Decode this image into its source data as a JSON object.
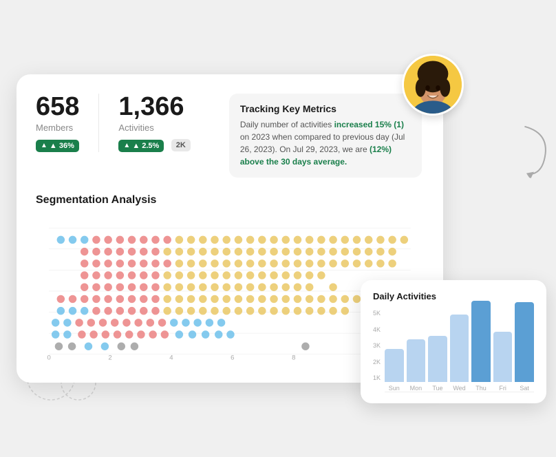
{
  "metrics": {
    "members": {
      "value": "658",
      "label": "Members",
      "badge": "▲ 36%"
    },
    "activities": {
      "value": "1,366",
      "label": "Activities",
      "badge": "▲ 2.5%",
      "extra": "2K"
    }
  },
  "tracking": {
    "title": "Tracking Key Metrics",
    "text_before_1": "Daily number of activities ",
    "highlight_1": "increased 15% (1)",
    "text_mid_1": " on 2023 when compared to previous day (Jul 26, 2023). On Jul 29, 2023, we are ",
    "highlight_2": "(12%) above the 30 days average.",
    "text_after_2": ""
  },
  "segmentation": {
    "title": "Segmentation Analysis"
  },
  "daily": {
    "title": "Daily Activities",
    "y_labels": [
      "5K",
      "4K",
      "3K",
      "2K",
      "1K"
    ],
    "bars": [
      {
        "day": "Sun",
        "value": 2000,
        "max": 5000,
        "highlight": false
      },
      {
        "day": "Mon",
        "value": 2600,
        "max": 5000,
        "highlight": false
      },
      {
        "day": "Tue",
        "value": 2800,
        "max": 5000,
        "highlight": false
      },
      {
        "day": "Wed",
        "value": 4100,
        "max": 5000,
        "highlight": false
      },
      {
        "day": "Thu",
        "value": 4900,
        "max": 5000,
        "highlight": true
      },
      {
        "day": "Fri",
        "value": 3050,
        "max": 5000,
        "highlight": false
      },
      {
        "day": "Sat",
        "value": 4850,
        "max": 5000,
        "highlight": true
      }
    ]
  },
  "scatter_dots": {
    "rows": [
      {
        "y": 190,
        "dots": [
          {
            "x": 10,
            "c": "#888"
          },
          {
            "x": 30,
            "c": "#888"
          },
          {
            "x": 50,
            "c": "#5bb8e8"
          },
          {
            "x": 75,
            "c": "#5bb8e8"
          },
          {
            "x": 95,
            "c": "#888"
          },
          {
            "x": 115,
            "c": "#888"
          }
        ]
      },
      {
        "y": 175,
        "dots": [
          {
            "x": 10,
            "c": "#5bb8e8"
          },
          {
            "x": 25,
            "c": "#5bb8e8"
          },
          {
            "x": 45,
            "c": "#e87070"
          },
          {
            "x": 60,
            "c": "#e87070"
          },
          {
            "x": 80,
            "c": "#e87070"
          },
          {
            "x": 95,
            "c": "#e87070"
          },
          {
            "x": 115,
            "c": "#e87070"
          },
          {
            "x": 135,
            "c": "#e87070"
          },
          {
            "x": 155,
            "c": "#e87070"
          },
          {
            "x": 175,
            "c": "#e87070"
          },
          {
            "x": 195,
            "c": "#5bb8e8"
          },
          {
            "x": 215,
            "c": "#5bb8e8"
          },
          {
            "x": 235,
            "c": "#5bb8e8"
          },
          {
            "x": 255,
            "c": "#5bb8e8"
          },
          {
            "x": 270,
            "c": "#5bb8e8"
          },
          {
            "x": 285,
            "c": "#888"
          },
          {
            "x": 380,
            "c": "#888"
          }
        ]
      },
      {
        "y": 158,
        "dots": [
          {
            "x": 10,
            "c": "#5bb8e8"
          },
          {
            "x": 25,
            "c": "#5bb8e8"
          },
          {
            "x": 42,
            "c": "#e87070"
          },
          {
            "x": 58,
            "c": "#e87070"
          },
          {
            "x": 75,
            "c": "#e87070"
          },
          {
            "x": 92,
            "c": "#e87070"
          },
          {
            "x": 108,
            "c": "#e87070"
          },
          {
            "x": 125,
            "c": "#e87070"
          },
          {
            "x": 142,
            "c": "#e87070"
          },
          {
            "x": 158,
            "c": "#e87070"
          },
          {
            "x": 175,
            "c": "#e87070"
          },
          {
            "x": 192,
            "c": "#5bb8e8"
          },
          {
            "x": 210,
            "c": "#5bb8e8"
          },
          {
            "x": 228,
            "c": "#5bb8e8"
          },
          {
            "x": 245,
            "c": "#5bb8e8"
          }
        ]
      },
      {
        "y": 140,
        "dots": [
          {
            "x": 18,
            "c": "#5bb8e8"
          },
          {
            "x": 35,
            "c": "#5bb8e8"
          },
          {
            "x": 52,
            "c": "#5bb8e8"
          },
          {
            "x": 70,
            "c": "#e87070"
          },
          {
            "x": 88,
            "c": "#e87070"
          },
          {
            "x": 106,
            "c": "#e87070"
          },
          {
            "x": 123,
            "c": "#e87070"
          },
          {
            "x": 140,
            "c": "#e87070"
          },
          {
            "x": 158,
            "c": "#e87070"
          },
          {
            "x": 175,
            "c": "#e87070"
          },
          {
            "x": 193,
            "c": "#e8c45b"
          },
          {
            "x": 212,
            "c": "#e8c45b"
          },
          {
            "x": 232,
            "c": "#e8c45b"
          },
          {
            "x": 252,
            "c": "#e8c45b"
          },
          {
            "x": 270,
            "c": "#e8c45b"
          },
          {
            "x": 288,
            "c": "#e8c45b"
          },
          {
            "x": 306,
            "c": "#e8c45b"
          },
          {
            "x": 324,
            "c": "#e8c45b"
          },
          {
            "x": 342,
            "c": "#e8c45b"
          },
          {
            "x": 360,
            "c": "#e8c45b"
          },
          {
            "x": 378,
            "c": "#e8c45b"
          },
          {
            "x": 398,
            "c": "#e8c45b"
          },
          {
            "x": 416,
            "c": "#e8c45b"
          },
          {
            "x": 432,
            "c": "#e8c45b"
          },
          {
            "x": 448,
            "c": "#e8c45b"
          }
        ]
      },
      {
        "y": 123,
        "dots": [
          {
            "x": 18,
            "c": "#e87070"
          },
          {
            "x": 35,
            "c": "#e87070"
          },
          {
            "x": 52,
            "c": "#e87070"
          },
          {
            "x": 70,
            "c": "#e87070"
          },
          {
            "x": 88,
            "c": "#e87070"
          },
          {
            "x": 106,
            "c": "#e87070"
          },
          {
            "x": 123,
            "c": "#e87070"
          },
          {
            "x": 140,
            "c": "#e87070"
          },
          {
            "x": 158,
            "c": "#e87070"
          },
          {
            "x": 175,
            "c": "#e8c45b"
          },
          {
            "x": 193,
            "c": "#e8c45b"
          },
          {
            "x": 212,
            "c": "#e8c45b"
          },
          {
            "x": 232,
            "c": "#e8c45b"
          },
          {
            "x": 252,
            "c": "#e8c45b"
          },
          {
            "x": 270,
            "c": "#e8c45b"
          },
          {
            "x": 288,
            "c": "#e8c45b"
          },
          {
            "x": 306,
            "c": "#e8c45b"
          },
          {
            "x": 324,
            "c": "#e8c45b"
          },
          {
            "x": 342,
            "c": "#e8c45b"
          },
          {
            "x": 360,
            "c": "#e8c45b"
          },
          {
            "x": 378,
            "c": "#e8c45b"
          },
          {
            "x": 398,
            "c": "#e8c45b"
          },
          {
            "x": 416,
            "c": "#e8c45b"
          },
          {
            "x": 432,
            "c": "#e8c45b"
          },
          {
            "x": 448,
            "c": "#e8c45b"
          },
          {
            "x": 466,
            "c": "#e8c45b"
          },
          {
            "x": 484,
            "c": "#e8c45b"
          },
          {
            "x": 502,
            "c": "#e8c45b"
          },
          {
            "x": 520,
            "c": "#e8c45b"
          }
        ]
      },
      {
        "y": 106,
        "dots": [
          {
            "x": 52,
            "c": "#e87070"
          },
          {
            "x": 70,
            "c": "#e87070"
          },
          {
            "x": 88,
            "c": "#e87070"
          },
          {
            "x": 106,
            "c": "#e87070"
          },
          {
            "x": 123,
            "c": "#e87070"
          },
          {
            "x": 140,
            "c": "#e87070"
          },
          {
            "x": 158,
            "c": "#e87070"
          },
          {
            "x": 175,
            "c": "#e8c45b"
          },
          {
            "x": 193,
            "c": "#e8c45b"
          },
          {
            "x": 212,
            "c": "#e8c45b"
          },
          {
            "x": 232,
            "c": "#e8c45b"
          },
          {
            "x": 252,
            "c": "#e8c45b"
          },
          {
            "x": 270,
            "c": "#e8c45b"
          },
          {
            "x": 288,
            "c": "#e8c45b"
          },
          {
            "x": 306,
            "c": "#e8c45b"
          },
          {
            "x": 324,
            "c": "#e8c45b"
          },
          {
            "x": 342,
            "c": "#e8c45b"
          },
          {
            "x": 360,
            "c": "#e8c45b"
          },
          {
            "x": 378,
            "c": "#e8c45b"
          },
          {
            "x": 398,
            "c": "#e8c45b"
          },
          {
            "x": 416,
            "c": "#e8c45b"
          },
          {
            "x": 448,
            "c": "#e8c45b"
          },
          {
            "x": 502,
            "c": "#e8c45b"
          },
          {
            "x": 518,
            "c": "#e8c45b"
          },
          {
            "x": 540,
            "c": "#e8c45b"
          }
        ]
      },
      {
        "y": 89,
        "dots": [
          {
            "x": 52,
            "c": "#e87070"
          },
          {
            "x": 70,
            "c": "#e87070"
          },
          {
            "x": 88,
            "c": "#e87070"
          },
          {
            "x": 106,
            "c": "#e87070"
          },
          {
            "x": 123,
            "c": "#e87070"
          },
          {
            "x": 140,
            "c": "#e87070"
          },
          {
            "x": 158,
            "c": "#e87070"
          },
          {
            "x": 175,
            "c": "#e8c45b"
          },
          {
            "x": 193,
            "c": "#e8c45b"
          },
          {
            "x": 212,
            "c": "#e8c45b"
          },
          {
            "x": 232,
            "c": "#e8c45b"
          },
          {
            "x": 252,
            "c": "#e8c45b"
          },
          {
            "x": 270,
            "c": "#e8c45b"
          },
          {
            "x": 288,
            "c": "#e8c45b"
          },
          {
            "x": 306,
            "c": "#e8c45b"
          },
          {
            "x": 324,
            "c": "#e8c45b"
          },
          {
            "x": 342,
            "c": "#e8c45b"
          },
          {
            "x": 360,
            "c": "#e8c45b"
          },
          {
            "x": 378,
            "c": "#e8c45b"
          },
          {
            "x": 398,
            "c": "#e8c45b"
          },
          {
            "x": 416,
            "c": "#e8c45b"
          },
          {
            "x": 434,
            "c": "#e8c45b"
          }
        ]
      },
      {
        "y": 72,
        "dots": [
          {
            "x": 52,
            "c": "#e87070"
          },
          {
            "x": 70,
            "c": "#e87070"
          },
          {
            "x": 88,
            "c": "#e87070"
          },
          {
            "x": 106,
            "c": "#e87070"
          },
          {
            "x": 123,
            "c": "#e87070"
          },
          {
            "x": 140,
            "c": "#e87070"
          },
          {
            "x": 158,
            "c": "#e87070"
          },
          {
            "x": 175,
            "c": "#e87070"
          },
          {
            "x": 193,
            "c": "#e8c45b"
          },
          {
            "x": 212,
            "c": "#e8c45b"
          },
          {
            "x": 232,
            "c": "#e8c45b"
          },
          {
            "x": 252,
            "c": "#e8c45b"
          },
          {
            "x": 270,
            "c": "#e8c45b"
          },
          {
            "x": 288,
            "c": "#e8c45b"
          },
          {
            "x": 306,
            "c": "#e8c45b"
          },
          {
            "x": 324,
            "c": "#e8c45b"
          },
          {
            "x": 342,
            "c": "#e8c45b"
          },
          {
            "x": 360,
            "c": "#e8c45b"
          },
          {
            "x": 378,
            "c": "#e8c45b"
          },
          {
            "x": 398,
            "c": "#e8c45b"
          },
          {
            "x": 416,
            "c": "#e8c45b"
          },
          {
            "x": 434,
            "c": "#e8c45b"
          },
          {
            "x": 448,
            "c": "#e8c45b"
          },
          {
            "x": 466,
            "c": "#e8c45b"
          },
          {
            "x": 484,
            "c": "#e8c45b"
          },
          {
            "x": 502,
            "c": "#e8c45b"
          },
          {
            "x": 520,
            "c": "#e8c45b"
          },
          {
            "x": 540,
            "c": "#e8c45b"
          }
        ]
      },
      {
        "y": 55,
        "dots": [
          {
            "x": 52,
            "c": "#e87070"
          },
          {
            "x": 70,
            "c": "#e87070"
          },
          {
            "x": 88,
            "c": "#e87070"
          },
          {
            "x": 106,
            "c": "#e87070"
          },
          {
            "x": 123,
            "c": "#e87070"
          },
          {
            "x": 140,
            "c": "#e87070"
          },
          {
            "x": 158,
            "c": "#e87070"
          },
          {
            "x": 175,
            "c": "#e8c45b"
          },
          {
            "x": 193,
            "c": "#e8c45b"
          },
          {
            "x": 212,
            "c": "#e8c45b"
          },
          {
            "x": 232,
            "c": "#e8c45b"
          },
          {
            "x": 252,
            "c": "#e8c45b"
          },
          {
            "x": 270,
            "c": "#e8c45b"
          },
          {
            "x": 288,
            "c": "#e8c45b"
          },
          {
            "x": 306,
            "c": "#e8c45b"
          },
          {
            "x": 324,
            "c": "#e8c45b"
          },
          {
            "x": 342,
            "c": "#e8c45b"
          },
          {
            "x": 360,
            "c": "#e8c45b"
          },
          {
            "x": 378,
            "c": "#e8c45b"
          },
          {
            "x": 398,
            "c": "#e8c45b"
          },
          {
            "x": 416,
            "c": "#e8c45b"
          },
          {
            "x": 434,
            "c": "#e8c45b"
          },
          {
            "x": 452,
            "c": "#e8c45b"
          },
          {
            "x": 470,
            "c": "#e8c45b"
          },
          {
            "x": 488,
            "c": "#e8c45b"
          },
          {
            "x": 506,
            "c": "#e8c45b"
          },
          {
            "x": 524,
            "c": "#e8c45b"
          },
          {
            "x": 542,
            "c": "#e8c45b"
          }
        ]
      },
      {
        "y": 36,
        "dots": [
          {
            "x": 18,
            "c": "#5bb8e8"
          },
          {
            "x": 35,
            "c": "#5bb8e8"
          },
          {
            "x": 52,
            "c": "#5bb8e8"
          },
          {
            "x": 70,
            "c": "#e87070"
          },
          {
            "x": 88,
            "c": "#e87070"
          },
          {
            "x": 106,
            "c": "#e87070"
          },
          {
            "x": 123,
            "c": "#e87070"
          },
          {
            "x": 140,
            "c": "#e87070"
          },
          {
            "x": 158,
            "c": "#e87070"
          },
          {
            "x": 175,
            "c": "#e87070"
          },
          {
            "x": 193,
            "c": "#e8c45b"
          },
          {
            "x": 212,
            "c": "#e8c45b"
          },
          {
            "x": 232,
            "c": "#e8c45b"
          },
          {
            "x": 252,
            "c": "#e8c45b"
          },
          {
            "x": 270,
            "c": "#e8c45b"
          },
          {
            "x": 288,
            "c": "#e8c45b"
          },
          {
            "x": 306,
            "c": "#e8c45b"
          },
          {
            "x": 324,
            "c": "#e8c45b"
          },
          {
            "x": 342,
            "c": "#e8c45b"
          },
          {
            "x": 360,
            "c": "#e8c45b"
          },
          {
            "x": 378,
            "c": "#e8c45b"
          },
          {
            "x": 398,
            "c": "#e8c45b"
          },
          {
            "x": 416,
            "c": "#e8c45b"
          },
          {
            "x": 434,
            "c": "#e8c45b"
          },
          {
            "x": 452,
            "c": "#e8c45b"
          },
          {
            "x": 470,
            "c": "#e8c45b"
          },
          {
            "x": 488,
            "c": "#e8c45b"
          },
          {
            "x": 506,
            "c": "#e8c45b"
          },
          {
            "x": 524,
            "c": "#e8c45b"
          },
          {
            "x": 542,
            "c": "#e8c45b"
          },
          {
            "x": 560,
            "c": "#e8c45b"
          }
        ]
      }
    ],
    "x_labels": [
      "0",
      "2",
      "4",
      "6",
      "8"
    ],
    "y_ticks": [
      10,
      36,
      72,
      108,
      144,
      180,
      208
    ]
  }
}
